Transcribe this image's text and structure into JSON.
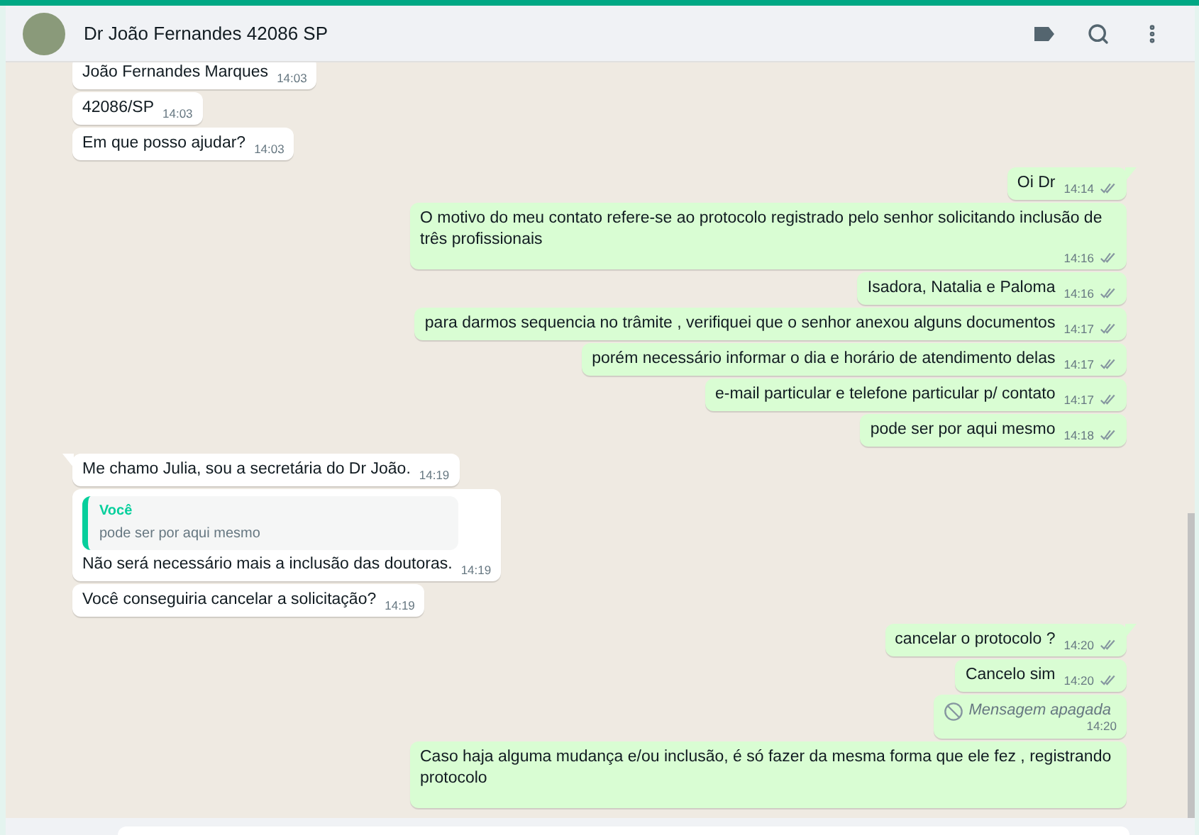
{
  "header": {
    "title": "Dr João Fernandes 42086 SP"
  },
  "messages": [
    {
      "outgoing": false,
      "kind": "text",
      "text": "João Fernandes Marques",
      "time": "14:03",
      "tail": false
    },
    {
      "outgoing": false,
      "kind": "text",
      "text": "42086/SP",
      "time": "14:03",
      "tail": false
    },
    {
      "outgoing": false,
      "kind": "text",
      "text": "Em que posso ajudar?",
      "time": "14:03",
      "tail": false
    },
    {
      "outgoing": true,
      "kind": "text",
      "text": "Oi Dr",
      "time": "14:14",
      "tail": true,
      "delivered": true
    },
    {
      "outgoing": true,
      "kind": "text",
      "text": "O motivo do meu contato refere-se ao protocolo registrado pelo senhor solicitando inclusão de três profissionais",
      "time": "14:16",
      "tail": false,
      "delivered": true
    },
    {
      "outgoing": true,
      "kind": "text",
      "text": "Isadora, Natalia e Paloma",
      "time": "14:16",
      "tail": false,
      "delivered": true
    },
    {
      "outgoing": true,
      "kind": "text",
      "text": "para darmos sequencia no trâmite , verifiquei que o senhor anexou alguns documentos",
      "time": "14:17",
      "tail": false,
      "delivered": true
    },
    {
      "outgoing": true,
      "kind": "text",
      "text": "porém necessário informar o dia e horário de atendimento delas",
      "time": "14:17",
      "tail": false,
      "delivered": true
    },
    {
      "outgoing": true,
      "kind": "text",
      "text": "e-mail particular e telefone particular p/ contato",
      "time": "14:17",
      "tail": false,
      "delivered": true
    },
    {
      "outgoing": true,
      "kind": "text",
      "text": "pode ser por aqui mesmo",
      "time": "14:18",
      "tail": false,
      "delivered": true
    },
    {
      "outgoing": false,
      "kind": "text",
      "text": "Me chamo Julia, sou a secretária do Dr João.",
      "time": "14:19",
      "tail": true
    },
    {
      "outgoing": false,
      "kind": "reply",
      "quote_author": "Você",
      "quote_text": "pode ser por aqui mesmo",
      "text": "Não será necessário mais a inclusão das doutoras.",
      "time": "14:19",
      "tail": false
    },
    {
      "outgoing": false,
      "kind": "text",
      "text": "Você conseguiria cancelar a solicitação?",
      "time": "14:19",
      "tail": false
    },
    {
      "outgoing": true,
      "kind": "text",
      "text": "cancelar o protocolo ?",
      "time": "14:20",
      "tail": true,
      "delivered": true
    },
    {
      "outgoing": true,
      "kind": "text",
      "text": "Cancelo sim",
      "time": "14:20",
      "tail": false,
      "delivered": true
    },
    {
      "outgoing": true,
      "kind": "deleted",
      "text": "Mensagem apagada",
      "time": "14:20",
      "tail": false
    },
    {
      "outgoing": true,
      "kind": "text",
      "text": "Caso haja alguma mudança e/ou inclusão, é só fazer da mesma forma que ele fez , registrando protocolo",
      "tail": false
    }
  ]
}
